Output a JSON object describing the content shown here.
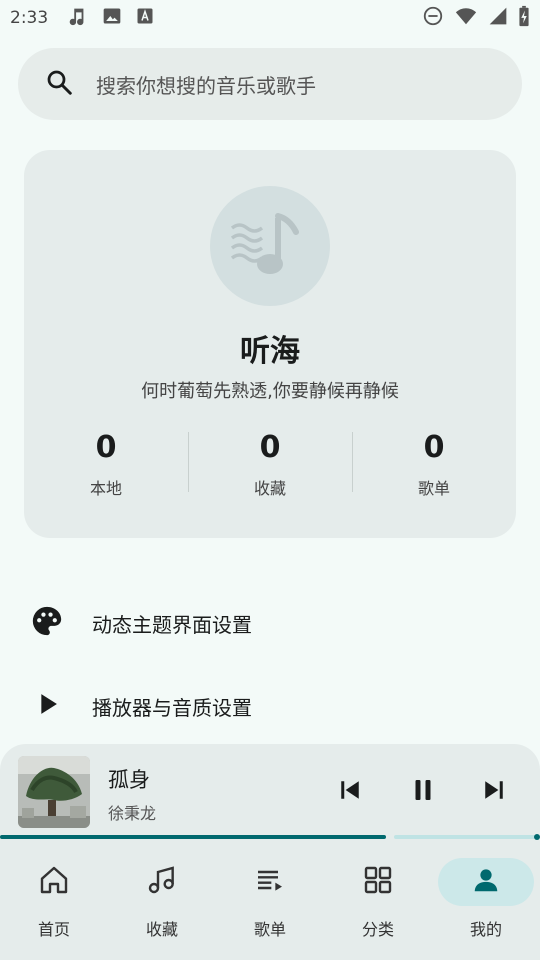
{
  "status_bar": {
    "time": "2:33",
    "left_icons": [
      "music-note-icon",
      "image-icon",
      "font-a-icon"
    ],
    "right_icons": [
      "do-not-disturb-icon",
      "wifi-icon",
      "signal-icon",
      "battery-charging-icon"
    ]
  },
  "search": {
    "placeholder": "搜索你想搜的音乐或歌手",
    "icon": "search-icon"
  },
  "profile": {
    "avatar_icon": "music-wave-note-icon",
    "name": "听海",
    "signature": "何时葡萄先熟透,你要静候再静候",
    "stats": [
      {
        "value": "0",
        "label": "本地"
      },
      {
        "value": "0",
        "label": "收藏"
      },
      {
        "value": "0",
        "label": "歌单"
      }
    ]
  },
  "menu": [
    {
      "icon": "palette-icon",
      "label": "动态主题界面设置"
    },
    {
      "icon": "play-icon",
      "label": "播放器与音质设置"
    }
  ],
  "player": {
    "title": "孤身",
    "artist": "徐秉龙",
    "progress": 0.72,
    "controls": [
      "previous-icon",
      "pause-icon",
      "next-icon"
    ]
  },
  "nav": {
    "active": "我的",
    "items": [
      {
        "icon": "home-icon",
        "label": "首页"
      },
      {
        "icon": "music-notes-icon",
        "label": "收藏"
      },
      {
        "icon": "playlist-icon",
        "label": "歌单"
      },
      {
        "icon": "grid-icon",
        "label": "分类"
      },
      {
        "icon": "person-icon",
        "label": "我的"
      }
    ]
  },
  "colors": {
    "background": "#f3faf8",
    "card": "#e5eceb",
    "accent": "#00696e",
    "nav_active_pill": "#cce8e9"
  }
}
